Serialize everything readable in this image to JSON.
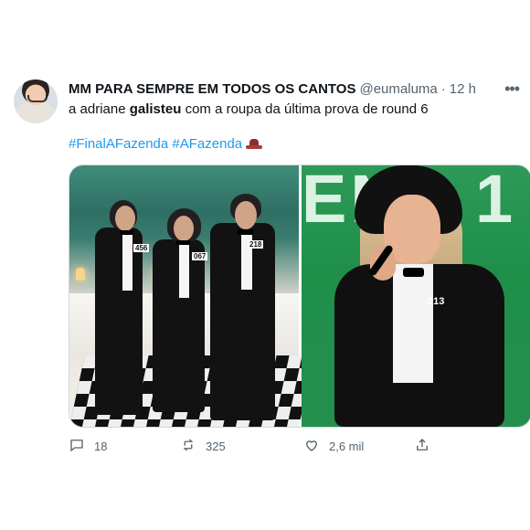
{
  "tweet": {
    "author": {
      "name": "MM PARA SEMPRE EM TODOS OS CANTOS",
      "handle": "@eumaluma",
      "time": "12 h"
    },
    "text_prefix": "a adriane ",
    "text_bold": "galisteu",
    "text_suffix": " com a roupa da última prova de round 6",
    "hashtags": "#FinalAFazenda #AFazenda",
    "media": {
      "left_numbers": [
        "456",
        "067",
        "218"
      ],
      "right_badge": "013",
      "right_bg_text": "ENA 1"
    },
    "actions": {
      "replies": "18",
      "retweets": "325",
      "likes": "2,6 mil"
    },
    "icons": {
      "reply": "comment-icon",
      "retweet": "retweet-icon",
      "like": "heart-icon",
      "share": "share-icon",
      "more": "more-icon"
    }
  }
}
